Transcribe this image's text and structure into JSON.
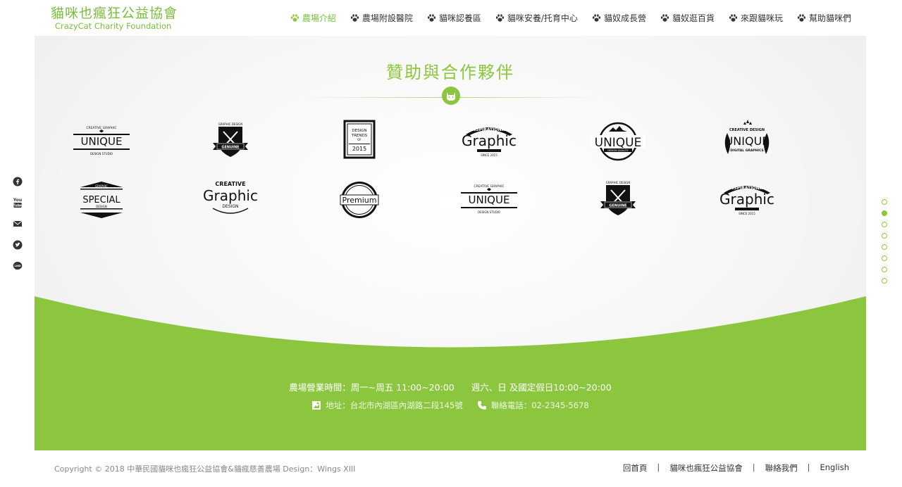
{
  "brand": {
    "name_cn": "貓咪也瘋狂公益協會",
    "name_en": "CrazyCat Charity Foundation",
    "accent_color": "#8cc63f"
  },
  "nav": {
    "items": [
      {
        "label": "農場介紹",
        "active": true,
        "icon": "paw-icon"
      },
      {
        "label": "農場附設醫院",
        "active": false,
        "icon": "paw-icon"
      },
      {
        "label": "貓咪認養區",
        "active": false,
        "icon": "paw-icon"
      },
      {
        "label": "貓咪安養/托育中心",
        "active": false,
        "icon": "paw-icon"
      },
      {
        "label": "貓奴成長營",
        "active": false,
        "icon": "paw-icon"
      },
      {
        "label": "貓奴逛百貨",
        "active": false,
        "icon": "paw-icon"
      },
      {
        "label": "來跟貓咪玩",
        "active": false,
        "icon": "paw-icon"
      },
      {
        "label": "幫助貓咪們",
        "active": false,
        "icon": "paw-icon"
      }
    ]
  },
  "sponsors": {
    "title": "贊助與合作夥伴",
    "badge_icon": "cat-face-icon",
    "logos": [
      {
        "name": "unique-ribbon",
        "top": "CREATIVE GRAPHIC",
        "main": "UNIQUE",
        "bottom": "DESIGN STUDIO"
      },
      {
        "name": "genuine-shield",
        "top": "GRAPHIC DESIGN",
        "main": "GENUINE",
        "bottom": ""
      },
      {
        "name": "design-trends-frame",
        "top": "DESIGN",
        "main": "TRENDS",
        "bottom": "2015",
        "extra": "OF"
      },
      {
        "name": "inspirational-graphic",
        "top": "INSPIRATIONAL",
        "main": "Graphic",
        "bottom": "SINCE 2015"
      },
      {
        "name": "unique-circle",
        "top": "",
        "main": "UNIQUE",
        "bottom": "DESIGN QUALITY"
      },
      {
        "name": "unique-laurel",
        "top": "CREATIVE DESIGN",
        "main": "UNIQUE",
        "bottom": "DIGITAL GRAPHICS"
      },
      {
        "name": "special-badge",
        "top": "GRAPHIC",
        "main": "SPECIAL",
        "bottom": "DESIGN"
      },
      {
        "name": "creative-graphic",
        "top": "CREATIVE",
        "main": "Graphic",
        "bottom": "DESIGN"
      },
      {
        "name": "premium-seal",
        "top": "",
        "main": "Premium",
        "bottom": ""
      },
      {
        "name": "unique-ribbon-2",
        "top": "CREATIVE GRAPHIC",
        "main": "UNIQUE",
        "bottom": "DESIGN STUDIO"
      },
      {
        "name": "genuine-shield-2",
        "top": "GRAPHIC DESIGN",
        "main": "GENUINE",
        "bottom": ""
      },
      {
        "name": "inspirational-graphic-2",
        "top": "INSPIRATIONAL",
        "main": "Graphic",
        "bottom": "SINCE 2015"
      }
    ]
  },
  "info": {
    "hours_weekday": "農場營業時間：周一~周五 11:00~20:00",
    "hours_weekend": "週六、日 及國定假日10:00~20:00",
    "address": "地址：台北市內湖區內湖路二段145號",
    "phone": "聯絡電話：02-2345-5678"
  },
  "footer": {
    "copyright": "Copyright © 2018 中華民國貓咪也瘋狂公益協會&貓瘋慈善農場 Design：Wings XIII",
    "links": [
      "回首頁",
      "貓咪也瘋狂公益協會",
      "聯絡我們",
      "English"
    ]
  },
  "social": [
    "facebook-icon",
    "youtube-icon",
    "mail-icon",
    "twitter-icon",
    "line-icon"
  ],
  "pager": {
    "count": 8,
    "active_index": 1
  }
}
